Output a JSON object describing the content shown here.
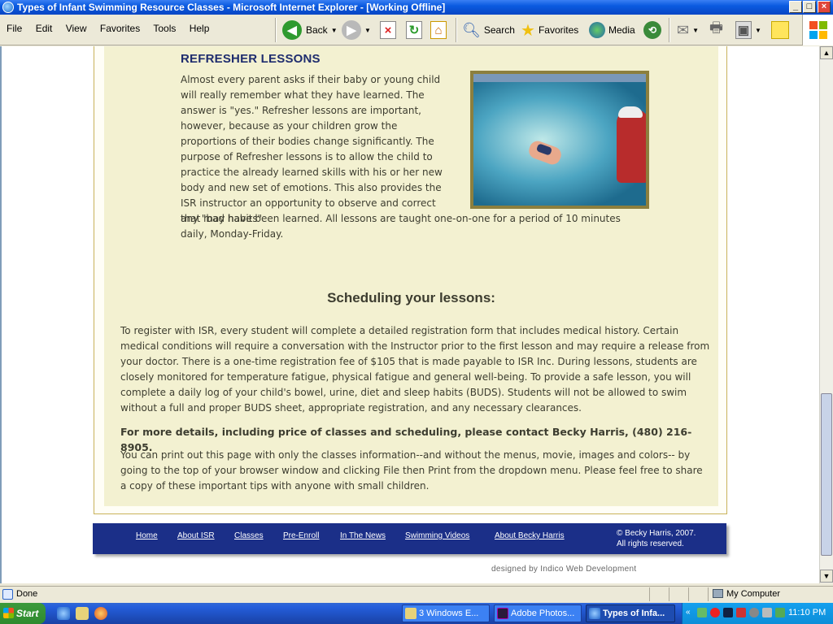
{
  "window": {
    "title": "Types of Infant Swimming Resource Classes - Microsoft Internet Explorer - [Working Offline]"
  },
  "menu": [
    "File",
    "Edit",
    "View",
    "Favorites",
    "Tools",
    "Help"
  ],
  "toolbar": {
    "back": "Back",
    "search": "Search",
    "favorites": "Favorites",
    "media": "Media"
  },
  "page": {
    "refresher_heading": "REFRESHER LESSONS",
    "refresher_text_narrow": "Almost every parent asks if their baby or young child will really remember what they have learned. The answer is \"yes.\" Refresher lessons are important, however, because as your children grow the proportions of their bodies change significantly. The purpose of Refresher lessons is to allow the child to practice the already learned skills with his or her new body and new set of emotions. This also provides the ISR instructor an opportunity to observe and correct any \"bad habits\"",
    "refresher_text_wide": "that may have been learned. All lessons are taught one-on-one for a period of 10 minutes daily, Monday-Friday.",
    "scheduling_heading": "Scheduling your lessons:",
    "registration_text": "To register with ISR, every student will complete a detailed registration form that includes medical history. Certain medical conditions will require a conversation with the Instructor prior to the first lesson and may require a release from your doctor. There is a one-time registration fee of $105 that is made payable to ISR Inc. During lessons, students are closely monitored for temperature fatigue, physical fatigue and general well-being. To provide a safe lesson, you will complete a daily log of your child's bowel, urine, diet and sleep habits (BUDS). Students will not be allowed to swim without a full and proper BUDS sheet, appropriate registration, and any necessary clearances.",
    "contact_text": "For more details, including price of classes and scheduling, please contact Becky Harris, (480) 216-8905.",
    "print_text": "You can print out this page with only the classes information--and without the menus, movie, images and colors-- by going to the top of your browser window and clicking File then Print from the dropdown menu. Please feel free to share a copy of these important tips with anyone with small children."
  },
  "footer": {
    "links": [
      "Home",
      "About ISR",
      "Classes",
      "Pre-Enroll",
      "In The News",
      "Swimming Videos",
      "About Becky Harris"
    ],
    "copyright_line1": "© Becky Harris, 2007.",
    "copyright_line2": "All rights reserved.",
    "credit": "designed by Indico Web Development"
  },
  "statusbar": {
    "status": "Done",
    "zone": "My Computer"
  },
  "taskbar": {
    "start": "Start",
    "tasks": [
      "3 Windows E...",
      "Adobe Photos...",
      "Types of Infa..."
    ],
    "clock": "11:10 PM"
  },
  "colors": {
    "heading_blue": "#1f2d6e",
    "panel_bg": "#f3f1d1",
    "footer_bg": "#1b2f88",
    "titlebar_blue": "#0a5ae0"
  }
}
